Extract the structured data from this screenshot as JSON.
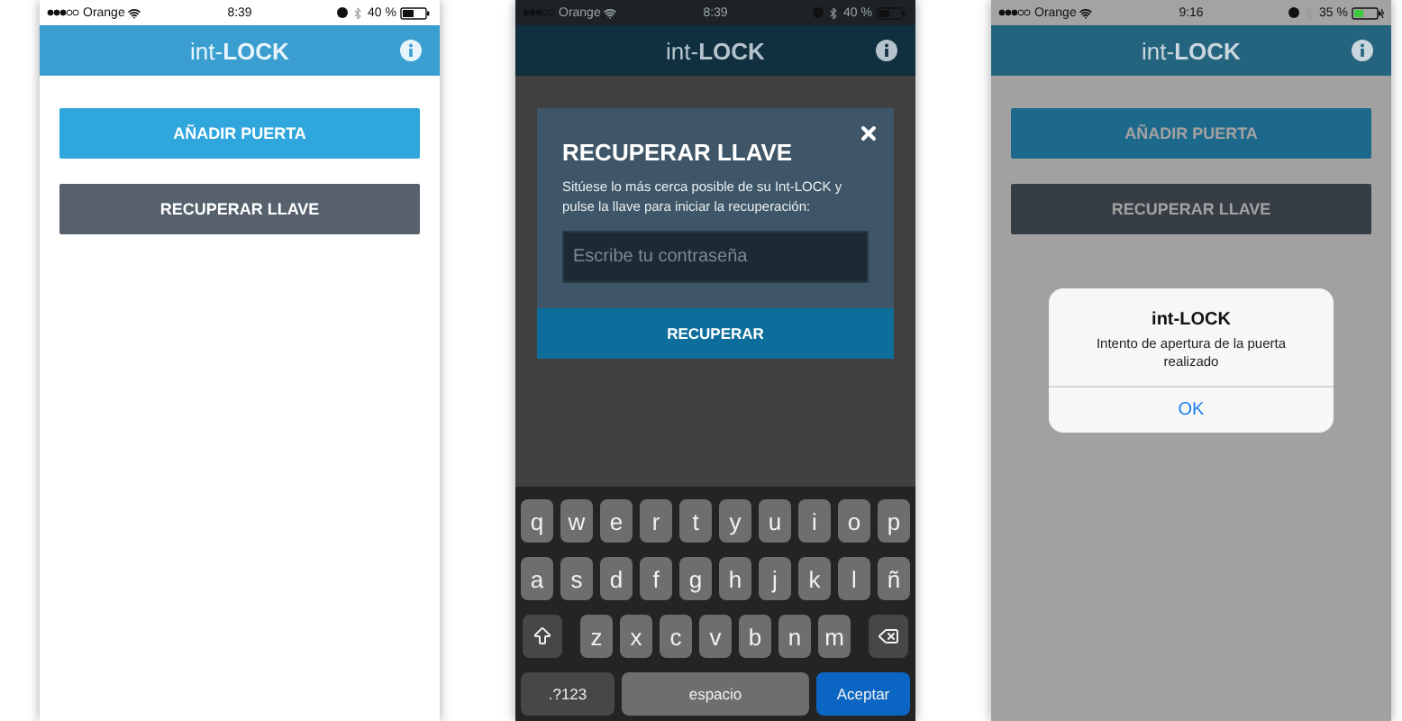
{
  "screens": [
    {
      "kind": "home",
      "status": {
        "carrier": "Orange",
        "time": "8:39",
        "battery": "40 %",
        "charging": false
      },
      "title": "int-**LOCK**",
      "buttons": [
        {
          "label": "AÑADIR PUERTA",
          "kind": "primary"
        },
        {
          "label": "RECUPERAR LLAVE",
          "kind": "secondary"
        }
      ]
    },
    {
      "kind": "dialog",
      "status": {
        "carrier": "Orange",
        "time": "8:39",
        "battery": "40 %",
        "charging": false
      },
      "title": "int-**LOCK**",
      "dialog": {
        "title": "RECUPERAR LLAVE",
        "text": "Sitúese lo más cerca posible de su Int-LOCK y pulse la llave para iniciar la recuperación:",
        "placeholder": "Escribe tu contraseña",
        "button": "RECUPERAR"
      },
      "keyboard": {
        "rows": [
          [
            "q",
            "w",
            "e",
            "r",
            "t",
            "y",
            "u",
            "i",
            "o",
            "p"
          ],
          [
            "a",
            "s",
            "d",
            "f",
            "g",
            "h",
            "j",
            "k",
            "l",
            "ñ"
          ],
          [
            "z",
            "x",
            "c",
            "v",
            "b",
            "n",
            "m"
          ]
        ],
        "numbers": ".?123",
        "space": "espacio",
        "return": "Aceptar"
      }
    },
    {
      "kind": "alert",
      "status": {
        "carrier": "Orange",
        "time": "9:16",
        "battery": "35 %",
        "charging": true
      },
      "title": "int-**LOCK**",
      "buttons": [
        {
          "label": "AÑADIR PUERTA",
          "kind": "primary"
        },
        {
          "label": "RECUPERAR LLAVE",
          "kind": "secondary"
        }
      ],
      "alert": {
        "title": "int-LOCK",
        "message": "Intento de apertura de la puerta realizado",
        "action": "OK"
      }
    }
  ]
}
